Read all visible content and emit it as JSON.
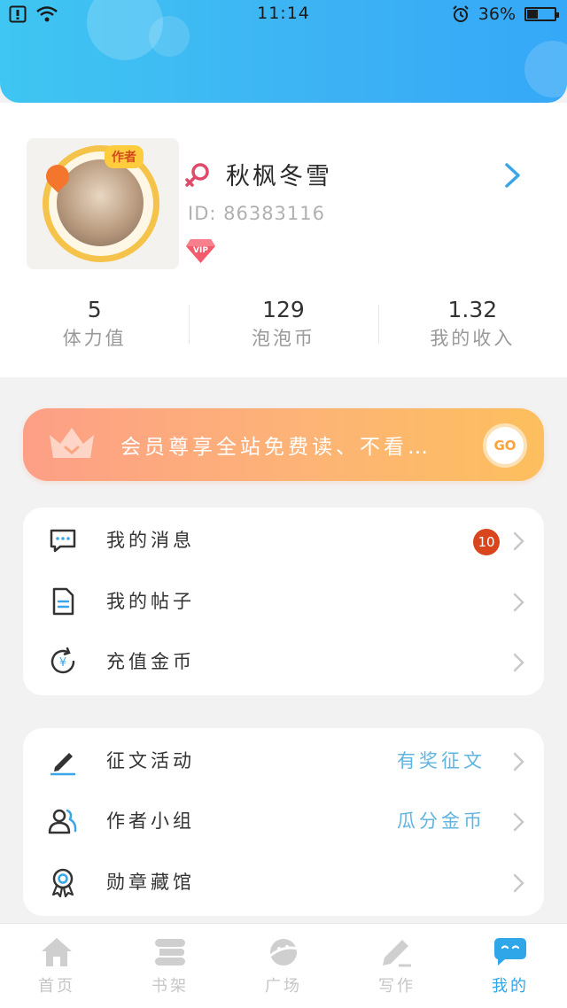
{
  "status_bar": {
    "time": "11:14",
    "battery_text": "36%",
    "battery_level": 0.36
  },
  "profile": {
    "avatar_badge": "作者",
    "username": "秋枫冬雪",
    "user_id": "ID: 86383116",
    "vip_badge": "VIP",
    "stats": [
      {
        "value": "5",
        "label": "体力值"
      },
      {
        "value": "129",
        "label": "泡泡币"
      },
      {
        "value": "1.32",
        "label": "我的收入"
      }
    ]
  },
  "vip_banner": {
    "text": "会员尊享全站免费读、不看…",
    "go_label": "GO"
  },
  "menu_group_1": [
    {
      "label": "我的消息",
      "badge": "10",
      "icon": "message-icon"
    },
    {
      "label": "我的帖子",
      "icon": "document-icon"
    },
    {
      "label": "充值金币",
      "icon": "recharge-coin-icon"
    }
  ],
  "menu_group_2": [
    {
      "label": "征文活动",
      "extra": "有奖征文",
      "icon": "pen-icon"
    },
    {
      "label": "作者小组",
      "extra": "瓜分金币",
      "icon": "group-icon"
    },
    {
      "label": "勋章藏馆",
      "icon": "medal-icon"
    }
  ],
  "bottom_nav": [
    {
      "label": "首页",
      "icon": "home-icon",
      "active": false
    },
    {
      "label": "书架",
      "icon": "bookshelf-icon",
      "active": false
    },
    {
      "label": "广场",
      "icon": "plaza-icon",
      "active": false
    },
    {
      "label": "写作",
      "icon": "write-icon",
      "active": false
    },
    {
      "label": "我的",
      "icon": "profile-chat-icon",
      "active": true
    }
  ],
  "colors": {
    "header_gradient_start": "#3fc6f2",
    "header_gradient_end": "#35a8f7",
    "banner_gradient_start": "#fd9f86",
    "banner_gradient_end": "#fdbf5e",
    "accent_blue": "#2fa6e8",
    "badge_red": "#d9461e"
  }
}
